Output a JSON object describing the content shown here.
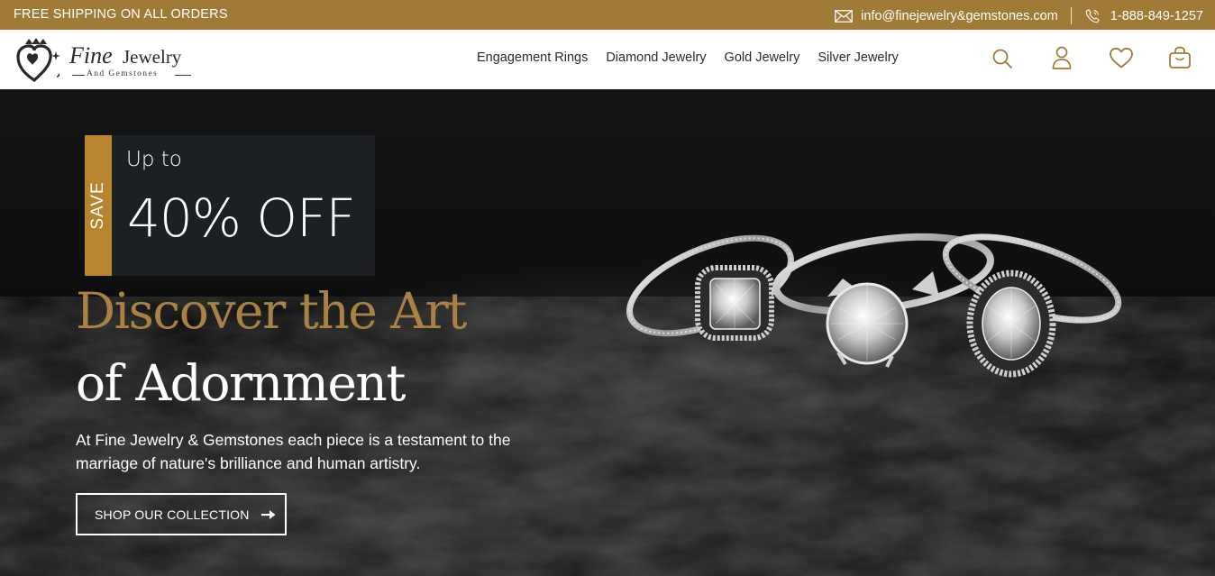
{
  "topbar": {
    "promo": "FREE SHIPPING ON ALL ORDERS",
    "email": "info@finejewelry&gemstones.com",
    "phone": "1-888-849-1257",
    "background": "#a07b37"
  },
  "brand": {
    "name_fine": "Fine",
    "name_jewelry": "Jewelry",
    "tagline": "And Gemstones"
  },
  "nav": {
    "items": [
      {
        "label": "Engagement Rings"
      },
      {
        "label": "Diamond Jewelry"
      },
      {
        "label": "Gold Jewelry"
      },
      {
        "label": "Silver Jewelry"
      }
    ]
  },
  "header_icons": [
    "search-icon",
    "user-icon",
    "heart-icon",
    "shopping-bag-icon"
  ],
  "hero": {
    "badge_save": "SAVE",
    "badge_upto": "Up to",
    "badge_offer": "40% OFF",
    "headline_line1": "Discover the Art",
    "headline_line2": "of Adornment",
    "description": "At Fine Jewelry & Gemstones each piece is a testament to the marriage of nature's brilliance and human artistry.",
    "cta_label": "SHOP OUR COLLECTION"
  },
  "colors": {
    "accent_gold": "#a88144",
    "badge_strip": "#b78530",
    "icon_gold": "#a07b37"
  }
}
